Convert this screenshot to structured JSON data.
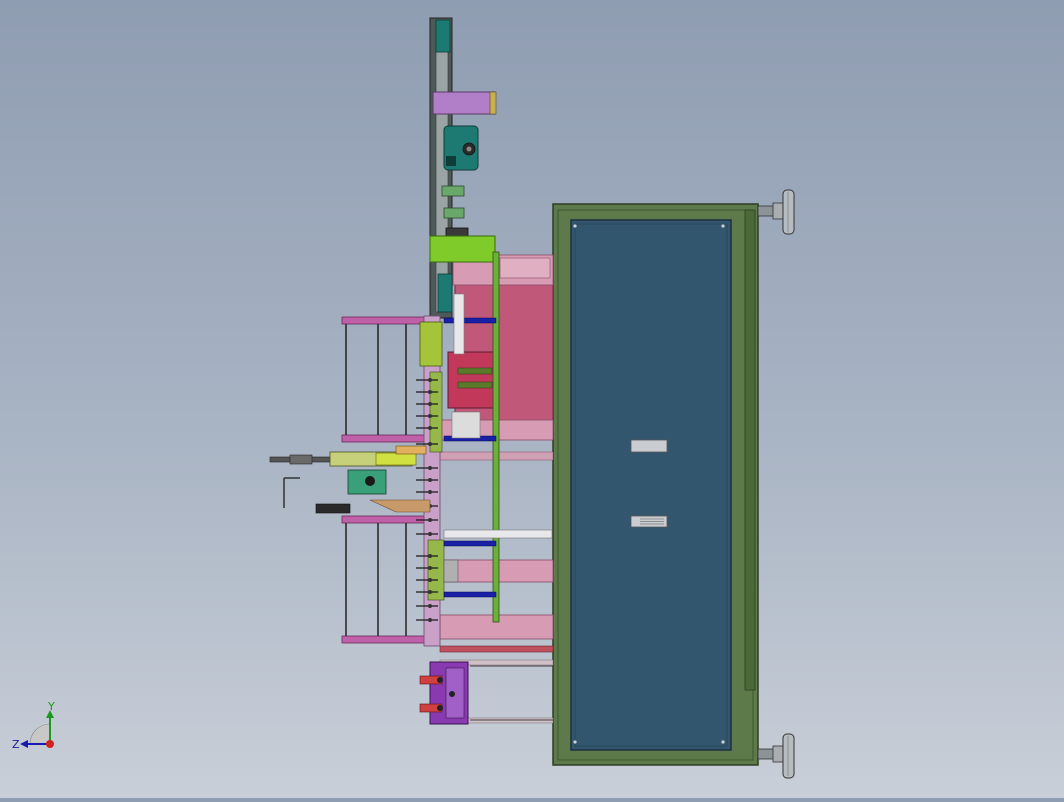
{
  "viewport": {
    "background_top": "#8f9db2",
    "background_bottom": "#c9cfd8"
  },
  "model": {
    "frame_color": "#5c7a4a",
    "panel_color": "#33566f",
    "plate_color": "#c0587a",
    "column_color": "#4e5a5a",
    "bar_color": "#1a1fa8",
    "accent_green": "#7ecb2a",
    "accent_purple": "#9a5ab8",
    "teal_color": "#1d7a72"
  },
  "triad": {
    "x_label": "X",
    "y_label": "Y",
    "z_label": "Z"
  }
}
